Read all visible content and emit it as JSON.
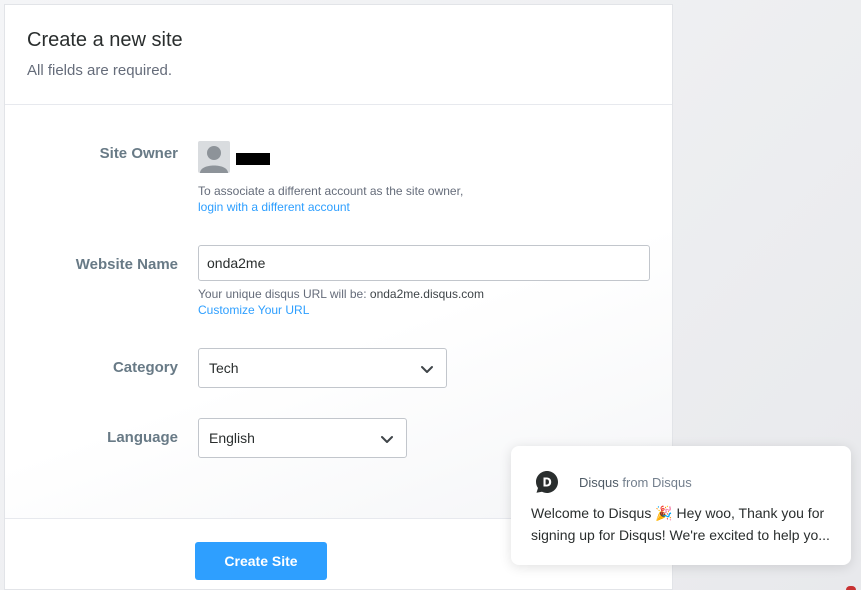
{
  "header": {
    "title": "Create a new site",
    "subtitle": "All fields are required."
  },
  "site_owner": {
    "label": "Site Owner",
    "help_text": "To associate a different account as the site owner,",
    "help_link": "login with a different account"
  },
  "website_name": {
    "label": "Website Name",
    "value": "onda2me",
    "help_prefix": "Your unique disqus URL will be:",
    "help_url": "onda2me.disqus.com",
    "help_link": "Customize Your URL"
  },
  "category": {
    "label": "Category",
    "selected": "Tech"
  },
  "language": {
    "label": "Language",
    "selected": "English"
  },
  "actions": {
    "create_label": "Create Site"
  },
  "chat": {
    "sender": "Disqus",
    "from_text": "from Disqus",
    "line1": "Welcome to Disqus 🎉 Hey woo, Thank you for",
    "line2": "signing up for Disqus! We're excited to help yo..."
  },
  "colors": {
    "accent": "#2e9fff",
    "label": "#687a86",
    "text": "#2a2e2e"
  },
  "icons": {
    "owner_avatar": "avatar-placeholder-icon",
    "dropdown": "chevron-down-icon",
    "chat_logo": "disqus-logo-icon"
  }
}
